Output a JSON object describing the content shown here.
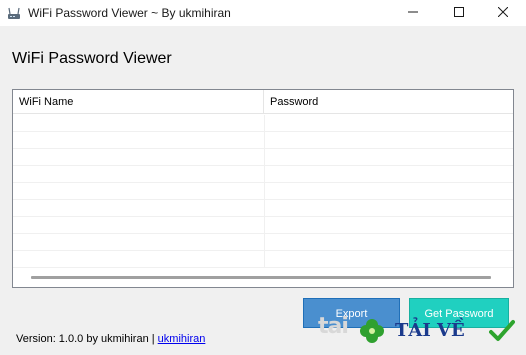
{
  "window": {
    "title": "WiFi Password Viewer ~ By ukmihiran",
    "controls": [
      "minimize-icon",
      "maximize-icon",
      "close-icon"
    ]
  },
  "main": {
    "heading": "WiFi Password Viewer",
    "table": {
      "columns": [
        "WiFi Name",
        "Password"
      ],
      "rows": []
    },
    "buttons": {
      "export_label": "Export",
      "get_password_label": "Get Password"
    }
  },
  "footer": {
    "version_text": "Version: 1.0.0 by ukmihiran |",
    "link_text": "ukmihiran"
  },
  "watermark": {
    "left_text": "tai",
    "brand_text": "TẢI VỀ",
    "icons": [
      "clover-icon",
      "checkmark-icon"
    ]
  },
  "colors": {
    "export_button": "#4a8fcf",
    "get_password_button": "#20d0c0",
    "brand": "#1b3a8c",
    "check": "#2ea42e",
    "clover": "#2fa02f"
  }
}
